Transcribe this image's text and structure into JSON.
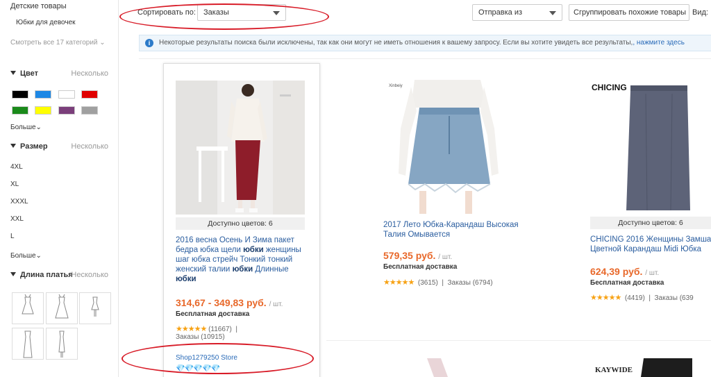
{
  "sidebar": {
    "category_children": "Детские товары",
    "category_sub": "Юбки для девочек",
    "view_all": "Смотреть все 17 категорий",
    "color_filter": {
      "title": "Цвет",
      "multi": "Несколько",
      "swatches": [
        "#000000",
        "#1e88e5",
        "#ffffff",
        "#e00000",
        "#1a8a1a",
        "#ffff00",
        "#7b3f7b",
        "#a0a0a0"
      ],
      "more": "Больше"
    },
    "size_filter": {
      "title": "Размер",
      "multi": "Несколько",
      "sizes": [
        "4XL",
        "XL",
        "XXXL",
        "XXL",
        "L"
      ],
      "more": "Больше"
    },
    "length_filter": {
      "title": "Длина платья",
      "multi": "Несколько"
    }
  },
  "toolbar": {
    "sort_label": "Сортировать по:",
    "sort_value": "Заказы",
    "ship_from": "Отправка из",
    "group_button": "Сгруппировать похожие товары",
    "view_label": "Вид:"
  },
  "notice": {
    "text": "Некоторые результаты поиска были исключены, так как они могут не иметь отношения к вашему запросу. Если вы хотите увидеть все результаты,",
    "link": ", нажмите здесь"
  },
  "products": [
    {
      "colors": "Доступно цветов: 6",
      "title_parts": [
        {
          "t": "2016 весна Осень И Зима пакет бедра юбка щели ",
          "b": false
        },
        {
          "t": "юбки",
          "b": true
        },
        {
          "t": " женщины шаг юбка стрейч Тонкий тонкий женский талии ",
          "b": false
        },
        {
          "t": "юбки",
          "b": true
        },
        {
          "t": " Длинные ",
          "b": false
        },
        {
          "t": "юбки",
          "b": true
        }
      ],
      "price": "314,67 - 349,83 руб.",
      "unit": "/ шт.",
      "shipping": "Бесплатная доставка",
      "stars": "★★★★★",
      "reviews": "(11667)",
      "orders": "Заказы (10915)",
      "store": "Shop1279250 Store",
      "gems": "💎💎💎💎💎"
    },
    {
      "title": "2017 Лето Юбка-Карандаш Высокая Талия Омывается",
      "price": "579,35 руб.",
      "unit": "/ шт.",
      "shipping": "Бесплатная доставка",
      "stars": "★★★★★",
      "reviews": "(3615)",
      "orders": "Заказы (6794)",
      "brand": "Xinbeiy"
    },
    {
      "colors": "Доступно цветов: 6",
      "title": "CHICING 2016 Женщины Замша Цветной Карандаш Midi Юбка",
      "price": "624,39 руб.",
      "unit": "/ шт.",
      "shipping": "Бесплатная доставка",
      "stars": "★★★★★",
      "reviews": "(4419)",
      "orders": "Заказы (639",
      "brand": "CHICING"
    }
  ],
  "bottom_brand": "KAYWIDE"
}
